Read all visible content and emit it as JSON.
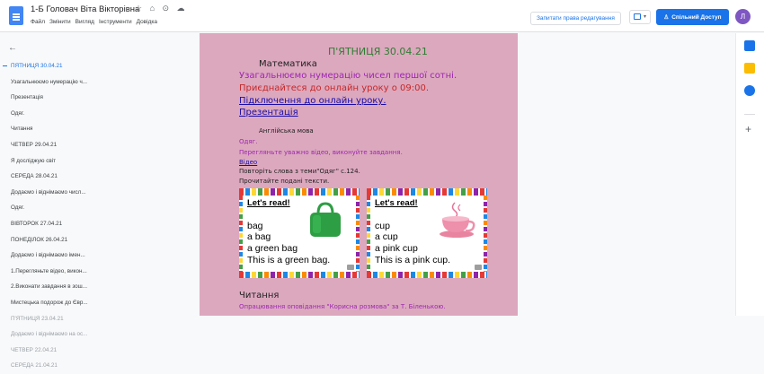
{
  "header": {
    "title": "1-Б Головач Віта Вікторівна",
    "title_icons": [
      "star-icon",
      "move-to-folder-icon",
      "history-icon",
      "cloud-status-icon"
    ],
    "title_icon_glyphs": "☆ ⌂ ⊙ ☁",
    "menu": [
      "Файл",
      "Змінити",
      "Вигляд",
      "Інструменти",
      "Довідка"
    ],
    "request_edit_label": "Запитати права редагування",
    "share_label": "Спільний Доступ",
    "share_icon": "person-icon",
    "avatar_letter": "Л",
    "colors": {
      "primary": "#1a73e8",
      "avatar": "#7e57c2"
    }
  },
  "outline": {
    "items": [
      {
        "label": "ПЯТНИЦЯ 30.04.21",
        "active": true
      },
      {
        "label": "Узагальнюємо нумерацію ч..."
      },
      {
        "label": "Презентація"
      },
      {
        "label": "Одяг."
      },
      {
        "label": "Читання"
      },
      {
        "label": "ЧЕТВЕР 29.04.21"
      },
      {
        "label": "Я досліджую світ"
      },
      {
        "label": "СЕРЕДА 28.04.21"
      },
      {
        "label": "Додаємо і віднімаємо числ..."
      },
      {
        "label": "Одяг."
      },
      {
        "label": "ВІВТОРОК 27.04.21"
      },
      {
        "label": "ПОНЕДІЛОК 26.04.21"
      },
      {
        "label": "Додаємо і віднімаємо імен..."
      },
      {
        "label": "1.Перегляньте відео, викон..."
      },
      {
        "label": "2.Виконати завдання в зош..."
      },
      {
        "label": "Мистецька подорож до Євр..."
      },
      {
        "label": "П'ЯТНИЦЯ 23.04.21"
      },
      {
        "label": "Додаємо і віднімаємо на ос..."
      },
      {
        "label": "ЧЕТВЕР 22.04.21"
      },
      {
        "label": "СЕРЕДА 21.04.21"
      }
    ]
  },
  "document": {
    "heading": "П'ЯТНИЦЯ 30.04.21",
    "math_title": "Математика",
    "math_line1": "Узагальнюємо нумерацію чисел першої сотні.",
    "math_line2": "Приєднайтеся до онлайн уроку о 09:00.",
    "math_link1": "Підключення до онлайн уроку.",
    "math_link2": "Презентація",
    "english_title": "Англійська мова",
    "english_topic": "Одяг.",
    "english_task": "Перегляньте уважно відео, виконуйте завдання.",
    "english_video": "Відео",
    "english_words": "Повторіть слова з теми\"Одяг\" с.124.",
    "english_read": "Прочитайте подані тексти.",
    "card1": {
      "heading": "Let's read!",
      "lines": [
        "bag",
        "a bag",
        "a green bag",
        "This is a green bag."
      ],
      "image": "green-bag-icon"
    },
    "card2": {
      "heading": "Let's read!",
      "lines": [
        "cup",
        "a cup",
        "a pink cup",
        "This is a pink cup."
      ],
      "image": "pink-cup-icon"
    },
    "reading_title": "Читання",
    "reading_line": "Опрацювання оповідання \"Корисна розмова\" за Т. Біленькою.",
    "colors": {
      "page_bg": "#dca8be",
      "heading": "#2e7d32",
      "math_purple": "#9c27b0",
      "math_red": "#c62828",
      "link": "#1a0dab"
    }
  },
  "rail": {
    "icons": [
      "calendar-icon",
      "keep-icon",
      "tasks-icon"
    ],
    "add_label": "+"
  }
}
